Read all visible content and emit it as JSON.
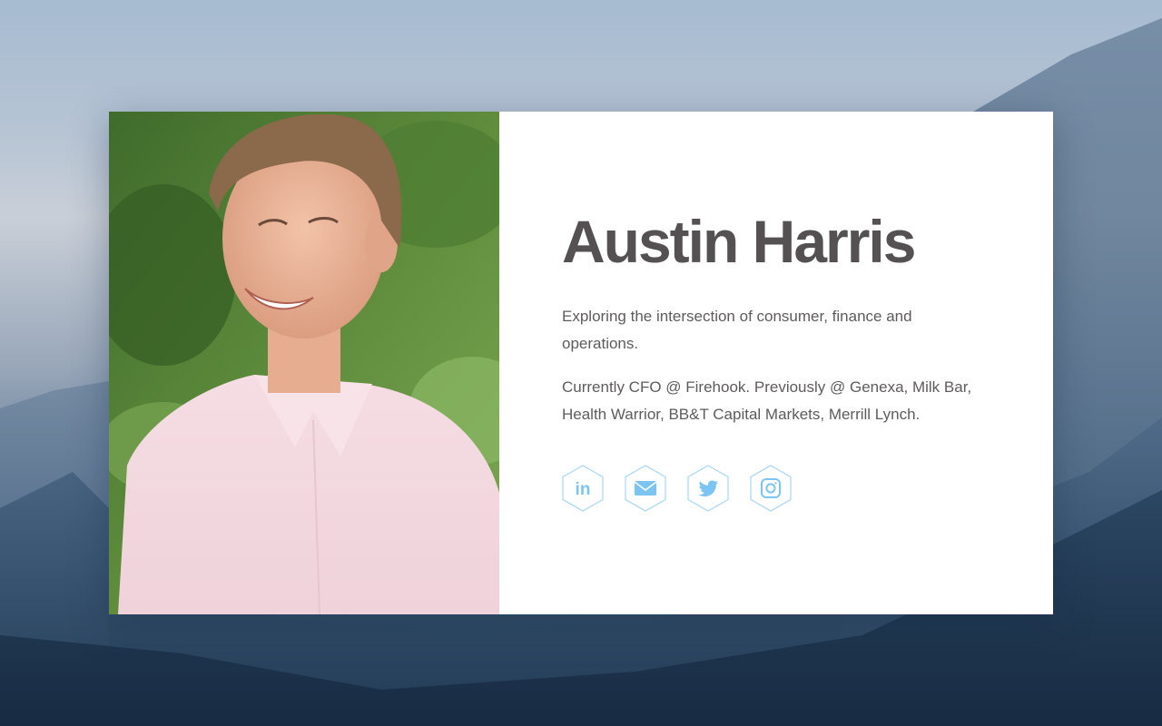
{
  "profile": {
    "name": "Austin Harris",
    "bio_line_1": "Exploring the intersection of consumer, finance and operations.",
    "bio_line_2": "Currently CFO @ Firehook. Previously @ Genexa, Milk Bar, Health Warrior, BB&T Capital Markets, Merrill Lynch."
  },
  "social": [
    {
      "icon": "linkedin-icon",
      "label": "in"
    },
    {
      "icon": "email-icon"
    },
    {
      "icon": "twitter-icon"
    },
    {
      "icon": "instagram-icon"
    }
  ],
  "colors": {
    "name_text": "#555152",
    "body_text": "#5e5b5c",
    "icon_accent": "#7cc4f2",
    "card_background": "#ffffff"
  }
}
